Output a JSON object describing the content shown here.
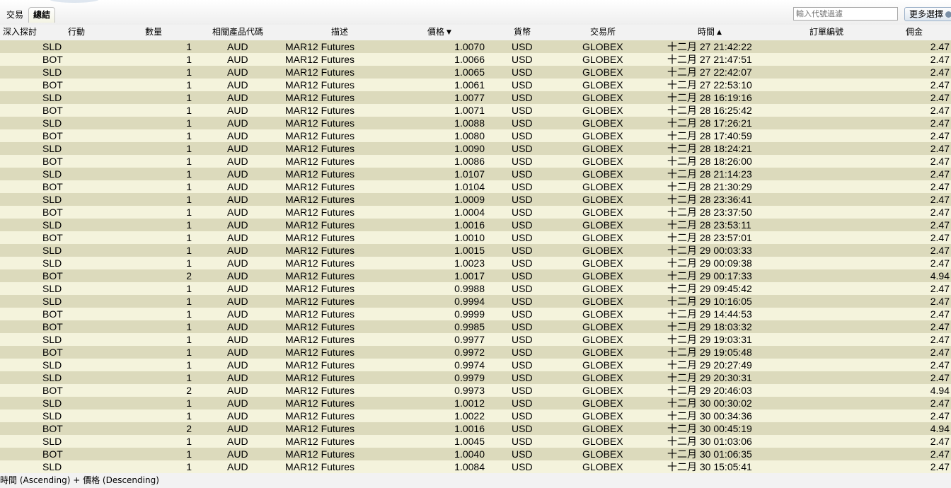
{
  "tabs": [
    {
      "label": "交易",
      "active": false
    },
    {
      "label": "總結",
      "active": true
    }
  ],
  "filter": {
    "placeholder": "輸入代號過濾",
    "value": ""
  },
  "more_button": {
    "label": "更多選擇"
  },
  "columns": {
    "drilldown": "深入探討",
    "action": "行動",
    "quantity": "數量",
    "symbol": "相關產品代碼",
    "description": "描述",
    "price": "價格",
    "currency": "貨幣",
    "exchange": "交易所",
    "time": "時間",
    "order_id": "訂單編號",
    "commission": "佣金"
  },
  "sort_indicators": {
    "price": "descending",
    "time": "ascending"
  },
  "rows": [
    {
      "action": "SLD",
      "qty": "1",
      "symbol": "AUD",
      "desc": "MAR12 Futures",
      "price": "1.0070",
      "currency": "USD",
      "exchange": "GLOBEX",
      "time": "十二月 27 21:42:22",
      "commission": "2.47"
    },
    {
      "action": "BOT",
      "qty": "1",
      "symbol": "AUD",
      "desc": "MAR12 Futures",
      "price": "1.0066",
      "currency": "USD",
      "exchange": "GLOBEX",
      "time": "十二月 27 21:47:51",
      "commission": "2.47"
    },
    {
      "action": "SLD",
      "qty": "1",
      "symbol": "AUD",
      "desc": "MAR12 Futures",
      "price": "1.0065",
      "currency": "USD",
      "exchange": "GLOBEX",
      "time": "十二月 27 22:42:07",
      "commission": "2.47"
    },
    {
      "action": "BOT",
      "qty": "1",
      "symbol": "AUD",
      "desc": "MAR12 Futures",
      "price": "1.0061",
      "currency": "USD",
      "exchange": "GLOBEX",
      "time": "十二月 27 22:53:10",
      "commission": "2.47"
    },
    {
      "action": "SLD",
      "qty": "1",
      "symbol": "AUD",
      "desc": "MAR12 Futures",
      "price": "1.0077",
      "currency": "USD",
      "exchange": "GLOBEX",
      "time": "十二月 28 16:19:16",
      "commission": "2.47"
    },
    {
      "action": "BOT",
      "qty": "1",
      "symbol": "AUD",
      "desc": "MAR12 Futures",
      "price": "1.0071",
      "currency": "USD",
      "exchange": "GLOBEX",
      "time": "十二月 28 16:25:42",
      "commission": "2.47"
    },
    {
      "action": "SLD",
      "qty": "1",
      "symbol": "AUD",
      "desc": "MAR12 Futures",
      "price": "1.0088",
      "currency": "USD",
      "exchange": "GLOBEX",
      "time": "十二月 28 17:26:21",
      "commission": "2.47"
    },
    {
      "action": "BOT",
      "qty": "1",
      "symbol": "AUD",
      "desc": "MAR12 Futures",
      "price": "1.0080",
      "currency": "USD",
      "exchange": "GLOBEX",
      "time": "十二月 28 17:40:59",
      "commission": "2.47"
    },
    {
      "action": "SLD",
      "qty": "1",
      "symbol": "AUD",
      "desc": "MAR12 Futures",
      "price": "1.0090",
      "currency": "USD",
      "exchange": "GLOBEX",
      "time": "十二月 28 18:24:21",
      "commission": "2.47"
    },
    {
      "action": "BOT",
      "qty": "1",
      "symbol": "AUD",
      "desc": "MAR12 Futures",
      "price": "1.0086",
      "currency": "USD",
      "exchange": "GLOBEX",
      "time": "十二月 28 18:26:00",
      "commission": "2.47"
    },
    {
      "action": "SLD",
      "qty": "1",
      "symbol": "AUD",
      "desc": "MAR12 Futures",
      "price": "1.0107",
      "currency": "USD",
      "exchange": "GLOBEX",
      "time": "十二月 28 21:14:23",
      "commission": "2.47"
    },
    {
      "action": "BOT",
      "qty": "1",
      "symbol": "AUD",
      "desc": "MAR12 Futures",
      "price": "1.0104",
      "currency": "USD",
      "exchange": "GLOBEX",
      "time": "十二月 28 21:30:29",
      "commission": "2.47"
    },
    {
      "action": "SLD",
      "qty": "1",
      "symbol": "AUD",
      "desc": "MAR12 Futures",
      "price": "1.0009",
      "currency": "USD",
      "exchange": "GLOBEX",
      "time": "十二月 28 23:36:41",
      "commission": "2.47"
    },
    {
      "action": "BOT",
      "qty": "1",
      "symbol": "AUD",
      "desc": "MAR12 Futures",
      "price": "1.0004",
      "currency": "USD",
      "exchange": "GLOBEX",
      "time": "十二月 28 23:37:50",
      "commission": "2.47"
    },
    {
      "action": "SLD",
      "qty": "1",
      "symbol": "AUD",
      "desc": "MAR12 Futures",
      "price": "1.0016",
      "currency": "USD",
      "exchange": "GLOBEX",
      "time": "十二月 28 23:53:11",
      "commission": "2.47"
    },
    {
      "action": "BOT",
      "qty": "1",
      "symbol": "AUD",
      "desc": "MAR12 Futures",
      "price": "1.0010",
      "currency": "USD",
      "exchange": "GLOBEX",
      "time": "十二月 28 23:57:01",
      "commission": "2.47"
    },
    {
      "action": "SLD",
      "qty": "1",
      "symbol": "AUD",
      "desc": "MAR12 Futures",
      "price": "1.0015",
      "currency": "USD",
      "exchange": "GLOBEX",
      "time": "十二月 29 00:03:33",
      "commission": "2.47"
    },
    {
      "action": "SLD",
      "qty": "1",
      "symbol": "AUD",
      "desc": "MAR12 Futures",
      "price": "1.0023",
      "currency": "USD",
      "exchange": "GLOBEX",
      "time": "十二月 29 00:09:38",
      "commission": "2.47"
    },
    {
      "action": "BOT",
      "qty": "2",
      "symbol": "AUD",
      "desc": "MAR12 Futures",
      "price": "1.0017",
      "currency": "USD",
      "exchange": "GLOBEX",
      "time": "十二月 29 00:17:33",
      "commission": "4.94"
    },
    {
      "action": "SLD",
      "qty": "1",
      "symbol": "AUD",
      "desc": "MAR12 Futures",
      "price": "0.9988",
      "currency": "USD",
      "exchange": "GLOBEX",
      "time": "十二月 29 09:45:42",
      "commission": "2.47"
    },
    {
      "action": "SLD",
      "qty": "1",
      "symbol": "AUD",
      "desc": "MAR12 Futures",
      "price": "0.9994",
      "currency": "USD",
      "exchange": "GLOBEX",
      "time": "十二月 29 10:16:05",
      "commission": "2.47"
    },
    {
      "action": "BOT",
      "qty": "1",
      "symbol": "AUD",
      "desc": "MAR12 Futures",
      "price": "0.9999",
      "currency": "USD",
      "exchange": "GLOBEX",
      "time": "十二月 29 14:44:53",
      "commission": "2.47"
    },
    {
      "action": "BOT",
      "qty": "1",
      "symbol": "AUD",
      "desc": "MAR12 Futures",
      "price": "0.9985",
      "currency": "USD",
      "exchange": "GLOBEX",
      "time": "十二月 29 18:03:32",
      "commission": "2.47"
    },
    {
      "action": "SLD",
      "qty": "1",
      "symbol": "AUD",
      "desc": "MAR12 Futures",
      "price": "0.9977",
      "currency": "USD",
      "exchange": "GLOBEX",
      "time": "十二月 29 19:03:31",
      "commission": "2.47"
    },
    {
      "action": "BOT",
      "qty": "1",
      "symbol": "AUD",
      "desc": "MAR12 Futures",
      "price": "0.9972",
      "currency": "USD",
      "exchange": "GLOBEX",
      "time": "十二月 29 19:05:48",
      "commission": "2.47"
    },
    {
      "action": "SLD",
      "qty": "1",
      "symbol": "AUD",
      "desc": "MAR12 Futures",
      "price": "0.9974",
      "currency": "USD",
      "exchange": "GLOBEX",
      "time": "十二月 29 20:27:49",
      "commission": "2.47"
    },
    {
      "action": "SLD",
      "qty": "1",
      "symbol": "AUD",
      "desc": "MAR12 Futures",
      "price": "0.9979",
      "currency": "USD",
      "exchange": "GLOBEX",
      "time": "十二月 29 20:30:31",
      "commission": "2.47"
    },
    {
      "action": "BOT",
      "qty": "2",
      "symbol": "AUD",
      "desc": "MAR12 Futures",
      "price": "0.9973",
      "currency": "USD",
      "exchange": "GLOBEX",
      "time": "十二月 29 20:46:03",
      "commission": "4.94"
    },
    {
      "action": "SLD",
      "qty": "1",
      "symbol": "AUD",
      "desc": "MAR12 Futures",
      "price": "1.0012",
      "currency": "USD",
      "exchange": "GLOBEX",
      "time": "十二月 30 00:30:02",
      "commission": "2.47"
    },
    {
      "action": "SLD",
      "qty": "1",
      "symbol": "AUD",
      "desc": "MAR12 Futures",
      "price": "1.0022",
      "currency": "USD",
      "exchange": "GLOBEX",
      "time": "十二月 30 00:34:36",
      "commission": "2.47"
    },
    {
      "action": "BOT",
      "qty": "2",
      "symbol": "AUD",
      "desc": "MAR12 Futures",
      "price": "1.0016",
      "currency": "USD",
      "exchange": "GLOBEX",
      "time": "十二月 30 00:45:19",
      "commission": "4.94"
    },
    {
      "action": "SLD",
      "qty": "1",
      "symbol": "AUD",
      "desc": "MAR12 Futures",
      "price": "1.0045",
      "currency": "USD",
      "exchange": "GLOBEX",
      "time": "十二月 30 01:03:06",
      "commission": "2.47"
    },
    {
      "action": "BOT",
      "qty": "1",
      "symbol": "AUD",
      "desc": "MAR12 Futures",
      "price": "1.0040",
      "currency": "USD",
      "exchange": "GLOBEX",
      "time": "十二月 30 01:06:35",
      "commission": "2.47"
    },
    {
      "action": "SLD",
      "qty": "1",
      "symbol": "AUD",
      "desc": "MAR12 Futures",
      "price": "1.0084",
      "currency": "USD",
      "exchange": "GLOBEX",
      "time": "十二月 30 15:05:41",
      "commission": "2.47"
    }
  ],
  "status_bar": {
    "text": "時間 (Ascending) + 價格 (Descending)"
  },
  "colors": {
    "row_odd": "#dcdabc",
    "row_even": "#f4f3dc"
  },
  "icons": {
    "price_sort": "sort-descending-arrow-icon",
    "time_sort": "sort-ascending-arrow-icon",
    "more_options": "gear-icon"
  }
}
